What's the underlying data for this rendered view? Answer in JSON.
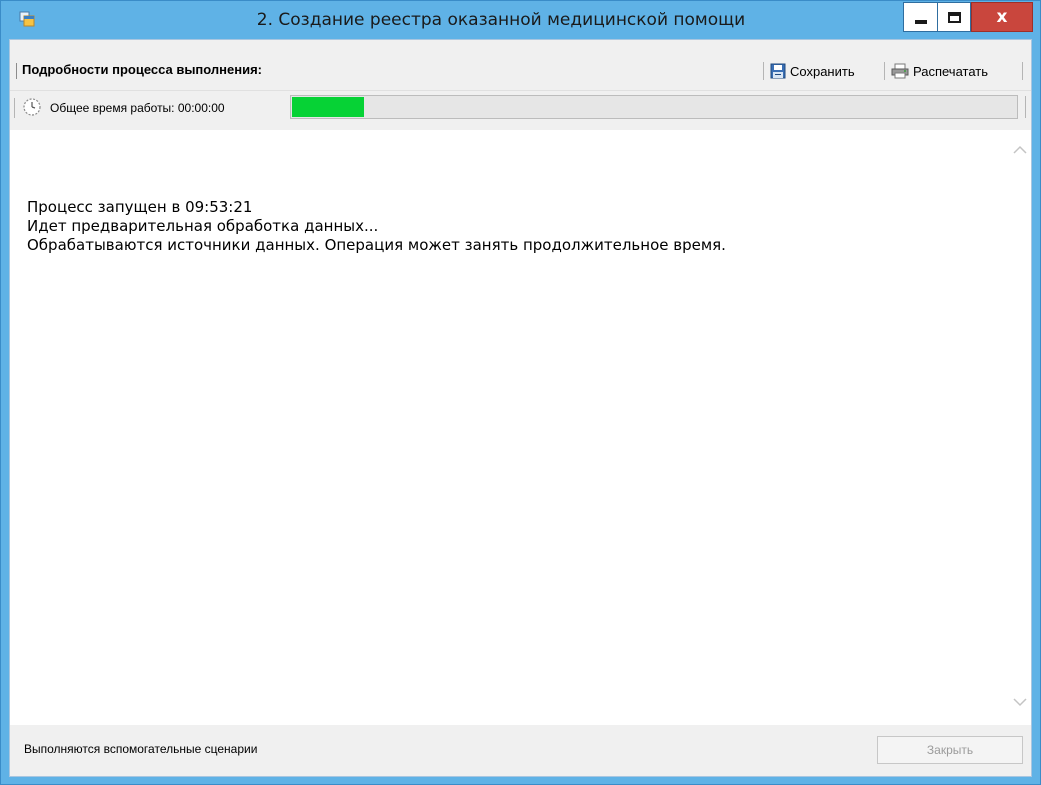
{
  "window": {
    "title": "2. Создание реестра оказанной медицинской помощи",
    "app_icon": "app-window-icon",
    "controls": {
      "minimize": "minimize-icon",
      "maximize": "maximize-icon",
      "close_glyph": "x"
    }
  },
  "toolbar": {
    "title": "Подробности процесса выполнения:",
    "save_label": "Сохранить",
    "save_icon": "floppy-disk-icon",
    "print_label": "Распечатать",
    "print_icon": "printer-icon"
  },
  "status": {
    "elapsed_label": "Общее время работы: 00:00:00",
    "clock_icon": "clock-icon",
    "progress_fraction": 0.1,
    "progress_color": "#06d235"
  },
  "log": {
    "lines": [
      "Процесс запущен в 09:53:21",
      "Идет предварительная обработка данных...",
      "Обрабатываются источники данных. Операция может занять продолжительное время."
    ]
  },
  "footer": {
    "status_text": "Выполняются вспомогательные сценарии",
    "close_label": "Закрыть",
    "close_enabled": false
  },
  "colors": {
    "titlebar": "#5fb2e6",
    "close_button": "#c9463d",
    "progress": "#06d235"
  }
}
